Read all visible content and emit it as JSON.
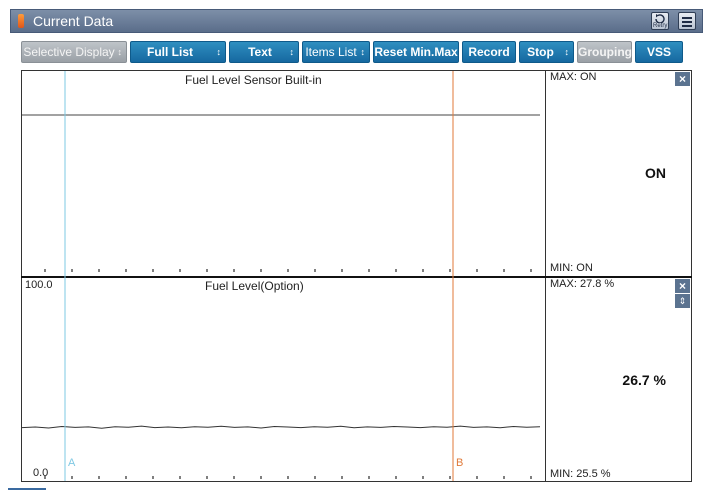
{
  "window": {
    "title": "Current Data",
    "retry_label": "Retry"
  },
  "toolbar": {
    "buttons": [
      {
        "label": "Selective Display",
        "arrows": "↕",
        "style": "gray"
      },
      {
        "label": "Full List",
        "arrows": "↕",
        "style": "blue"
      },
      {
        "label": "Text",
        "arrows": "↕",
        "style": "blue"
      },
      {
        "label": "Items List",
        "arrows": "↕",
        "style": "blue"
      },
      {
        "label": "Reset Min.Max",
        "style": "blue"
      },
      {
        "label": "Record",
        "style": "blue"
      },
      {
        "label": "Stop",
        "arrows": "↕",
        "style": "blue"
      },
      {
        "label": "Grouping",
        "style": "gray"
      },
      {
        "label": "VSS",
        "style": "blue"
      }
    ]
  },
  "charts": [
    {
      "title": "Fuel Level Sensor Built-in",
      "max_text": "MAX: ON",
      "min_text": "MIN: ON",
      "current_value": "ON",
      "y_top_label": "",
      "y_bottom_label": ""
    },
    {
      "title": "Fuel Level(Option)",
      "max_text": "MAX:  27.8 %",
      "min_text": "MIN:  25.5 %",
      "current_value": "26.7 %",
      "y_top_label": "100.0",
      "y_bottom_label": "0.0"
    }
  ],
  "cursors": {
    "a_label": "A",
    "b_label": "B",
    "a_color": "#7ec8e3",
    "b_color": "#e07a3a"
  },
  "chart_data": [
    {
      "type": "line",
      "title": "Fuel Level Sensor Built-in",
      "series": [
        {
          "values": [
            1,
            1,
            1,
            1,
            1,
            1,
            1,
            1,
            1,
            1
          ]
        }
      ],
      "ylim": [
        0,
        1
      ]
    },
    {
      "type": "line",
      "title": "Fuel Level(Option)",
      "ylim": [
        0,
        100
      ],
      "series": [
        {
          "values": [
            26.1,
            26.4,
            25.9,
            26.7,
            26.2,
            26.5,
            25.8,
            26.6,
            26.3,
            26.9,
            26.1,
            26.4,
            26.0,
            26.6,
            26.3,
            26.8,
            26.2,
            26.5,
            25.9,
            26.7,
            26.4,
            26.1,
            26.6,
            26.3,
            26.8,
            26.0,
            26.5,
            26.2,
            26.7,
            26.4,
            26.1,
            26.6,
            26.3,
            26.9,
            26.2,
            26.5,
            26.0,
            26.7,
            26.3,
            26.6
          ]
        }
      ]
    }
  ]
}
